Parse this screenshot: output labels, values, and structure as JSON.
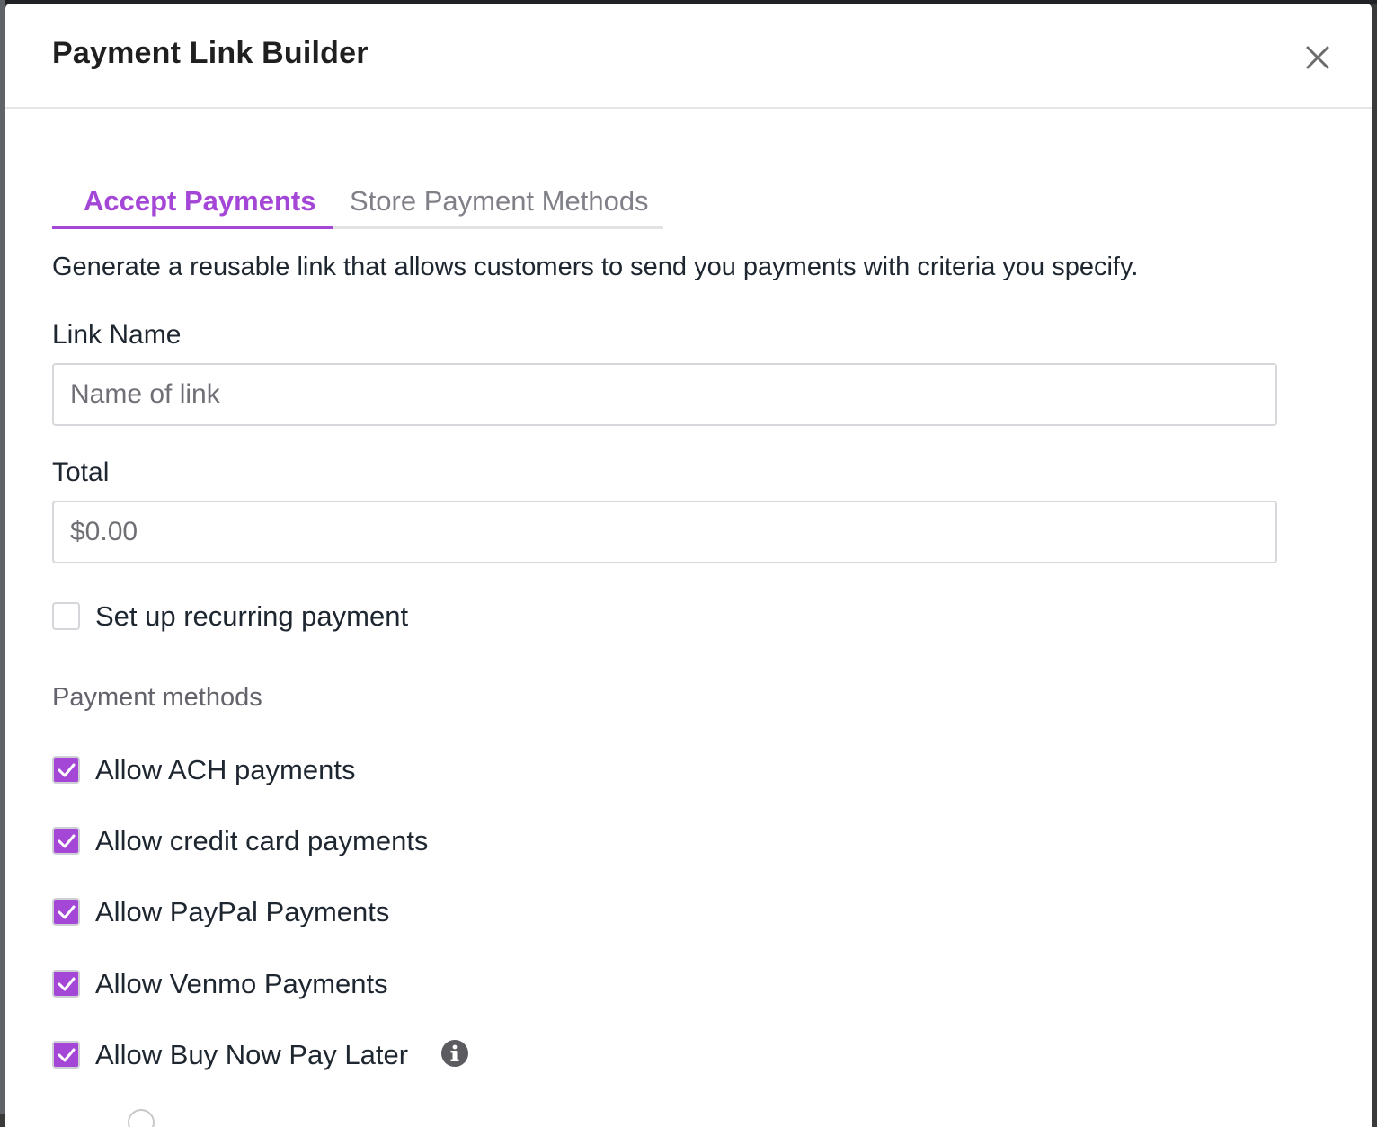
{
  "modal": {
    "title": "Payment Link Builder",
    "close_icon": "close-icon"
  },
  "tabs": [
    {
      "label": "Accept Payments",
      "active": true
    },
    {
      "label": "Store Payment Methods",
      "active": false
    }
  ],
  "description": "Generate a reusable link that allows customers to send you payments with criteria you specify.",
  "form": {
    "link_name_label": "Link Name",
    "link_name_placeholder": "Name of link",
    "link_name_value": "",
    "total_label": "Total",
    "total_placeholder": "$0.00",
    "total_value": "",
    "recurring_label": "Set up recurring payment",
    "recurring_checked": false
  },
  "payment_methods": {
    "heading": "Payment methods",
    "options": [
      {
        "label": "Allow ACH payments",
        "checked": true
      },
      {
        "label": "Allow credit card payments",
        "checked": true
      },
      {
        "label": "Allow PayPal Payments",
        "checked": true
      },
      {
        "label": "Allow Venmo Payments",
        "checked": true
      },
      {
        "label": "Allow Buy Now Pay Later",
        "checked": true,
        "info_icon": "info-icon"
      }
    ]
  },
  "colors": {
    "accent": "#a547d6",
    "text": "#1e2630",
    "muted": "#63636b"
  }
}
